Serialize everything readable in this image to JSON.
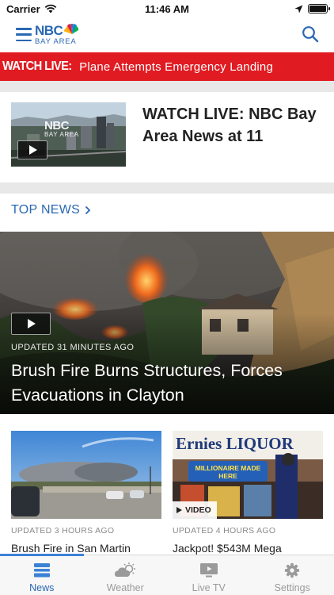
{
  "status_bar": {
    "carrier": "Carrier",
    "time": "11:46 AM"
  },
  "header": {
    "logo_text": "NBC",
    "logo_subtext": "BAY AREA"
  },
  "breaking": {
    "label": "WATCH LIVE:",
    "text": "Plane Attempts Emergency Landing"
  },
  "live_card": {
    "title": "WATCH LIVE: NBC Bay Area News at 11",
    "thumb_logo_text": "NBC",
    "thumb_logo_subtext": "BAY AREA"
  },
  "top_news": {
    "section_title": "TOP NEWS",
    "hero": {
      "meta": "UPDATED 31 MINUTES AGO",
      "title": "Brush Fire Burns Structures, Forces Evacuations in Clayton"
    },
    "cards": [
      {
        "meta": "UPDATED 3 HOURS AGO",
        "title": "Brush Fire in San Martin"
      },
      {
        "meta": "UPDATED 4 HOURS AGO",
        "title": "Jackpot! $543M Mega",
        "badge": "VIDEO",
        "sign_text": "Ernies LIQUOR",
        "banner_text": "MILLIONAIRE MADE HERE"
      }
    ]
  },
  "tabs": [
    {
      "label": "News",
      "icon": "news-icon",
      "active": true
    },
    {
      "label": "Weather",
      "icon": "weather-icon",
      "active": false
    },
    {
      "label": "Live TV",
      "icon": "live-tv-icon",
      "active": false
    },
    {
      "label": "Settings",
      "icon": "gear-icon",
      "active": false
    }
  ],
  "colors": {
    "brand_blue": "#2a68b3",
    "breaking_red": "#e11b22",
    "tab_active": "#3b82d6"
  }
}
